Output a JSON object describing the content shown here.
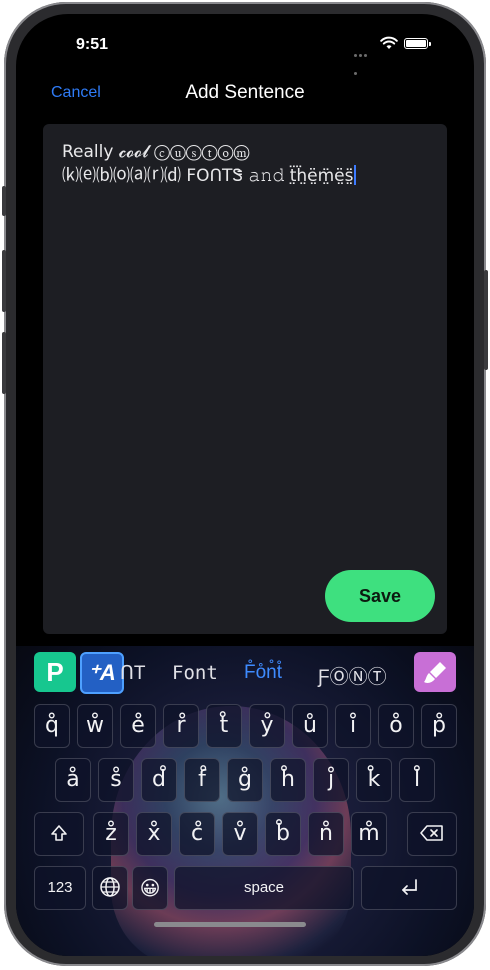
{
  "status": {
    "time": "9:51"
  },
  "nav": {
    "cancel": "Cancel",
    "title": "Add Sentence"
  },
  "editor": {
    "line1": "Really 𝓬𝓸𝓸𝓵 ⓒⓤⓢⓣⓞⓜ",
    "line2": "⒦⒠⒝⒪⒜⒭⒟ FOՈTᏕ 𝚊𝚗𝚍 ẗ̤ḧ̤ë̤m̤̈ë̤s̤̈"
  },
  "save_label": "Save",
  "font_bar": {
    "p_label": "P",
    "a_label": "⁺A",
    "options": [
      "ՈT",
      "Font",
      "F̊o̊n̊t̊",
      "ƑⓄⓃⓉ"
    ],
    "active_index": 2
  },
  "keyboard": {
    "row1": [
      "q̊",
      "ẘ",
      "e̊",
      "r̊",
      "t̊",
      "ẙ",
      "ů",
      "i̊",
      "o̊",
      "p̊"
    ],
    "row2": [
      "å",
      "s̊",
      "d̊",
      "f̊",
      "g̊",
      "h̊",
      "j̊",
      "k̊",
      "l̊"
    ],
    "row3": [
      "z̊",
      "x̊",
      "c̊",
      "v̊",
      "b̊",
      "n̊",
      "m̊"
    ],
    "numbers_label": "123",
    "space_label": "space",
    "emoji": "😀"
  }
}
